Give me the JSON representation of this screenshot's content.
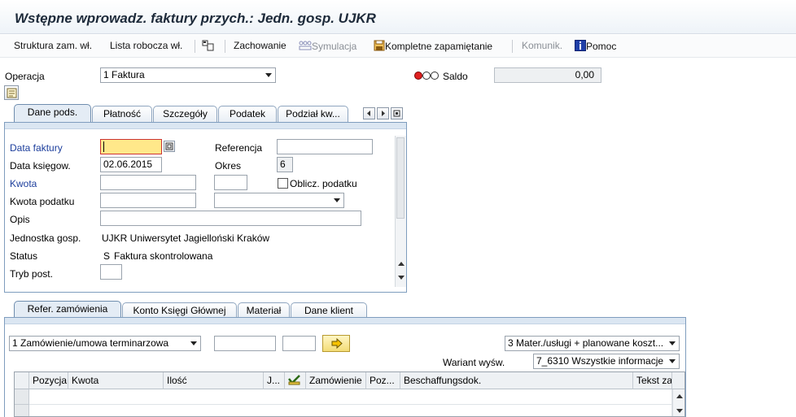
{
  "window": {
    "title": "Wstępne wprowadz. faktury przych.: Jedn. gosp. UJKR"
  },
  "toolbar": {
    "struktura": "Struktura zam. wł.",
    "lista": "Lista robocza wł.",
    "zachowanie": "Zachowanie",
    "symulacja": "Symulacja",
    "kompletne": "Kompletne zapamiętanie",
    "komunik": "Komunik.",
    "pomoc": "Pomoc"
  },
  "header": {
    "operacja_label": "Operacja",
    "operacja_value": "1 Faktura",
    "saldo_label": "Saldo",
    "saldo_value": "0,00"
  },
  "tabs_top": [
    "Dane pods.",
    "Płatność",
    "Szczegóły",
    "Podatek",
    "Podział kw..."
  ],
  "form": {
    "data_faktury_label": "Data faktury",
    "data_faktury_value": "",
    "referencja_label": "Referencja",
    "referencja_value": "",
    "data_ksiegow_label": "Data księgow.",
    "data_ksiegow_value": "02.06.2015",
    "okres_label": "Okres",
    "okres_value": "6",
    "kwota_label": "Kwota",
    "kwota_value": "",
    "oblicz_label": "Oblicz. podatku",
    "kwota_podatku_label": "Kwota podatku",
    "opis_label": "Opis",
    "jednostka_label": "Jednostka gosp.",
    "jednostka_value": "UJKR Uniwersytet Jagielloński Kraków",
    "status_label": "Status",
    "status_code": "S",
    "status_value": "Faktura skontrolowana",
    "tryb_label": "Tryb post."
  },
  "tabs_bottom": [
    "Refer. zamówienia",
    "Konto Księgi Głównej",
    "Materiał",
    "Dane klient"
  ],
  "ref": {
    "type_value": "1 Zamówienie/umowa terminarzowa",
    "layout_value": "3 Mater./usługi + planowane koszt...",
    "wariant_label": "Wariant wyśw.",
    "wariant_value": "7_6310 Wszystkie informacje"
  },
  "grid": {
    "columns": [
      "Pozycja",
      "Kwota",
      "Ilość",
      "J...",
      "",
      "Zamówienie",
      "Poz...",
      "Beschaffungsdok.",
      "Tekst za"
    ]
  },
  "colors": {
    "tab_border": "#7f9dbe",
    "focus_bg": "#ffe88a",
    "label_blue": "#1c3e9c"
  }
}
